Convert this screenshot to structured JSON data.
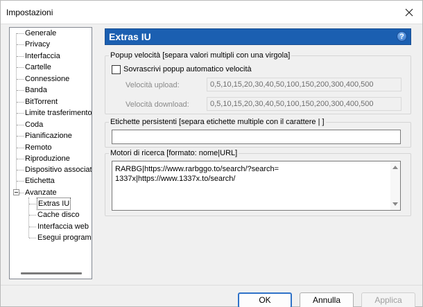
{
  "window": {
    "title": "Impostazioni"
  },
  "tree": {
    "items": [
      {
        "label": "Generale"
      },
      {
        "label": "Privacy"
      },
      {
        "label": "Interfaccia"
      },
      {
        "label": "Cartelle"
      },
      {
        "label": "Connessione"
      },
      {
        "label": "Banda"
      },
      {
        "label": "BitTorrent"
      },
      {
        "label": "Limite trasferimento"
      },
      {
        "label": "Coda"
      },
      {
        "label": "Pianificazione"
      },
      {
        "label": "Remoto"
      },
      {
        "label": "Riproduzione"
      },
      {
        "label": "Dispositivo associato"
      },
      {
        "label": "Etichetta"
      },
      {
        "label": "Avanzate"
      }
    ],
    "children": [
      {
        "label": "Extras IU",
        "selected": true
      },
      {
        "label": "Cache disco"
      },
      {
        "label": "Interfaccia web"
      },
      {
        "label": "Esegui programma"
      }
    ]
  },
  "panel": {
    "title": "Extras IU",
    "help": "?",
    "popup_group": {
      "label": "Popup velocità [separa valori multipli con una virgola]",
      "override_label": "Sovrascrivi popup automatico velocità",
      "override_checked": false,
      "upload_label": "Velocità upload:",
      "upload_value": "0,5,10,15,20,30,40,50,100,150,200,300,400,500",
      "download_label": "Velocità download:",
      "download_value": "0,5,10,15,20,30,40,50,100,150,200,300,400,500"
    },
    "labels_group": {
      "label": "Etichette persistenti [separa etichette multiple con il carattere | ]",
      "value": ""
    },
    "search_group": {
      "label": "Motori di ricerca [formato: nome|URL]",
      "value": "RARBG|https://www.rarbggo.to/search/?search=\n1337x|https://www.1337x.to/search/"
    }
  },
  "buttons": {
    "ok": "OK",
    "cancel": "Annulla",
    "apply": "Applica"
  },
  "colors": {
    "header_bg": "#1b5fb1",
    "primary_border": "#2f72c8"
  }
}
